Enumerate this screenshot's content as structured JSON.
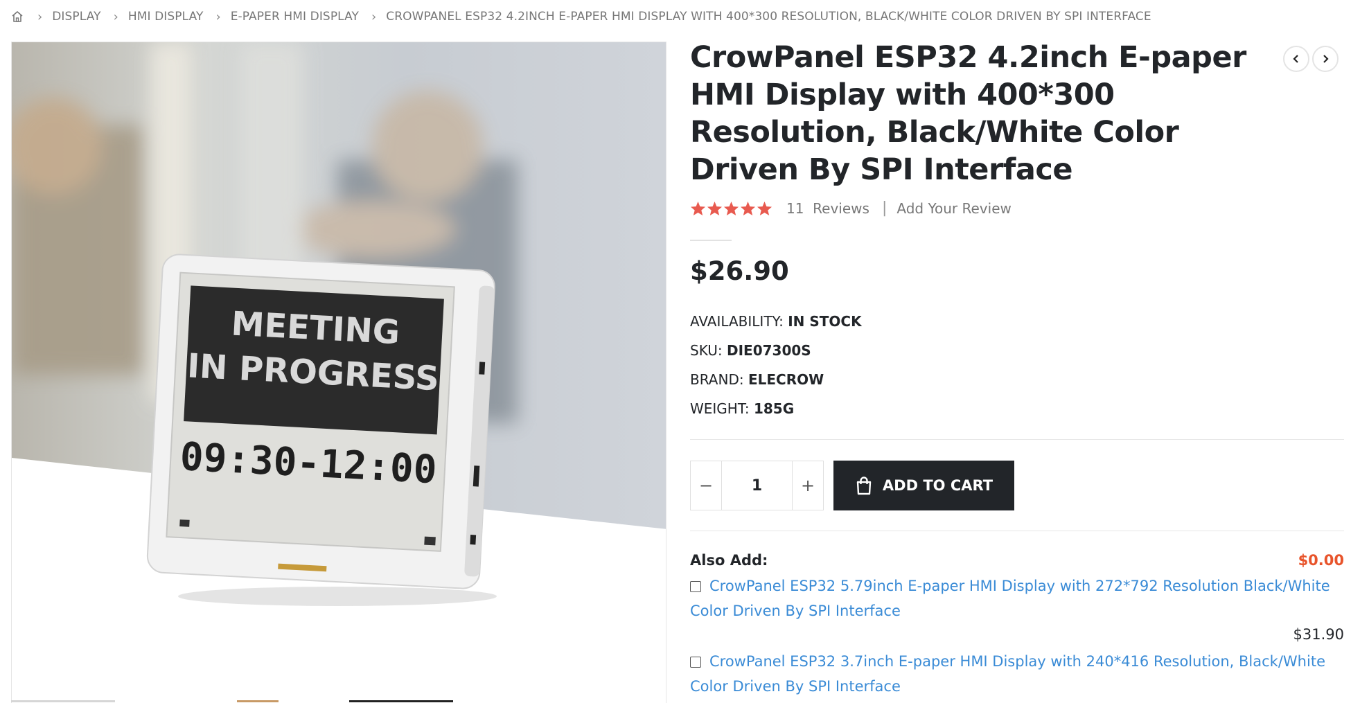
{
  "breadcrumb": {
    "items": [
      {
        "label": "DISPLAY"
      },
      {
        "label": "HMI DISPLAY"
      },
      {
        "label": "E-PAPER HMI DISPLAY"
      },
      {
        "label": "CROWPANEL ESP32 4.2INCH E-PAPER HMI DISPLAY WITH 400*300 RESOLUTION, BLACK/WHITE COLOR DRIVEN BY SPI INTERFACE"
      }
    ]
  },
  "gallery": {
    "screen_line1": "MEETING",
    "screen_line2": "IN PROGRESS",
    "screen_time": "09:30-12:00"
  },
  "product": {
    "title": "CrowPanel ESP32 4.2inch E-paper HMI Display with 400*300 Resolution, Black/White Color Driven By SPI Interface",
    "rating_stars": 5,
    "reviews_count": "11",
    "reviews_label": "Reviews",
    "add_review": "Add Your Review",
    "price": "$26.90",
    "availability_label": "AVAILABILITY:",
    "availability_value": "IN STOCK",
    "sku_label": "SKU:",
    "sku_value": "DIE07300S",
    "brand_label": "BRAND:",
    "brand_value": "ELECROW",
    "weight_label": "WEIGHT:",
    "weight_value": "185G"
  },
  "cart": {
    "quantity": "1",
    "minus": "−",
    "plus": "+",
    "add_to_cart": "ADD TO CART"
  },
  "also_add": {
    "label": "Also Add:",
    "total": "$0.00",
    "items": [
      {
        "name": "CrowPanel ESP32 5.79inch E-paper HMI Display with 272*792 Resolution Black/White Color Driven By SPI Interface",
        "price": "$31.90"
      },
      {
        "name": "CrowPanel ESP32 3.7inch E-paper HMI Display with 240*416 Resolution, Black/White Color Driven By SPI Interface"
      }
    ]
  },
  "colors": {
    "accent": "#e8542b",
    "link": "#3a8bd6",
    "dark": "#222529",
    "star": "#e85a4f"
  },
  "icons": {
    "home": "home-icon",
    "chevron": "chevron-right-icon",
    "bag": "shopping-bag-icon",
    "prev": "chevron-left-icon",
    "next": "chevron-right-icon"
  }
}
